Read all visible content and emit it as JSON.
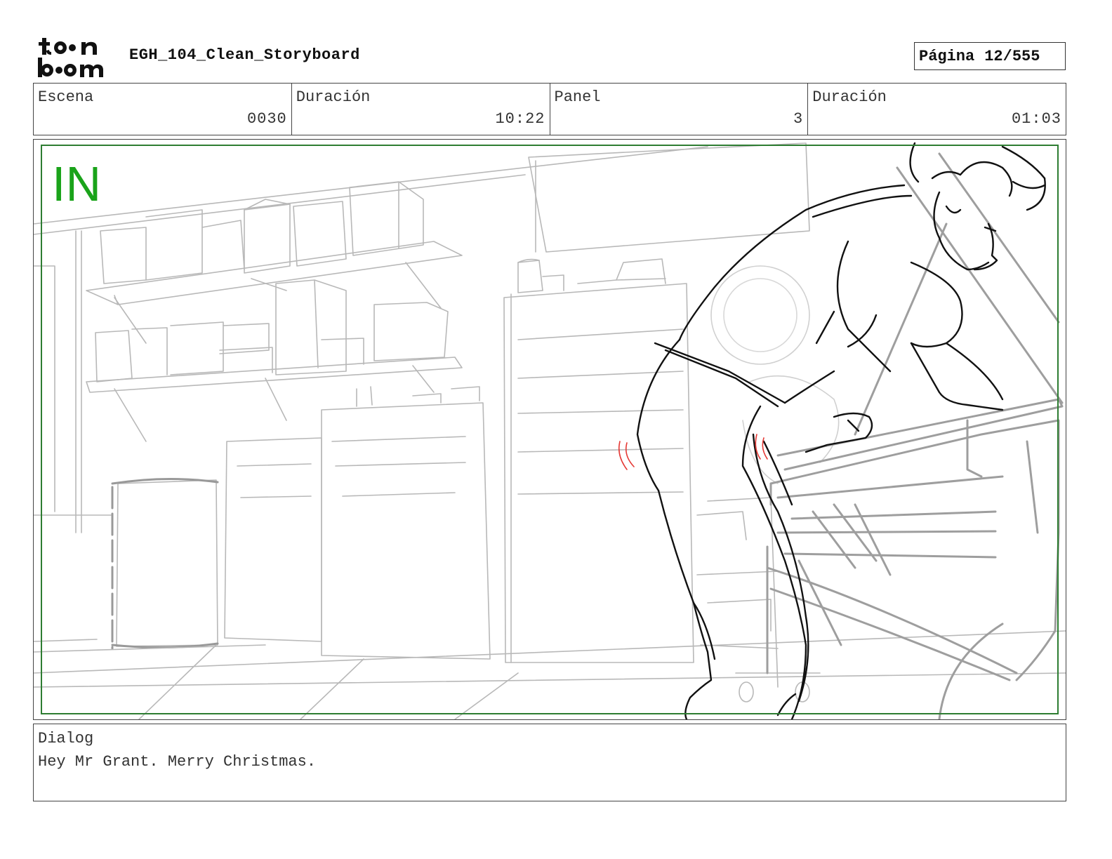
{
  "logo": {
    "line1": "toon",
    "line2": "boom"
  },
  "header": {
    "title": "EGH_104_Clean_Storyboard",
    "page_label": "Página",
    "page_value": "12/555"
  },
  "info": {
    "scene_label": "Escena",
    "scene_value": "0030",
    "scene_duration_label": "Duración",
    "scene_duration_value": "10:22",
    "panel_label": "Panel",
    "panel_value": "3",
    "panel_duration_label": "Duración",
    "panel_duration_value": "01:03"
  },
  "panel": {
    "transition_mark": "IN",
    "transition_color": "#1aa31a",
    "safe_frame_color": "#2e7d32",
    "sketch_line_color": "#b5b5b5",
    "character_line_color": "#111111",
    "accent_color": "#e53935"
  },
  "dialog": {
    "label": "Dialog",
    "text": "Hey Mr Grant. Merry Christmas."
  }
}
